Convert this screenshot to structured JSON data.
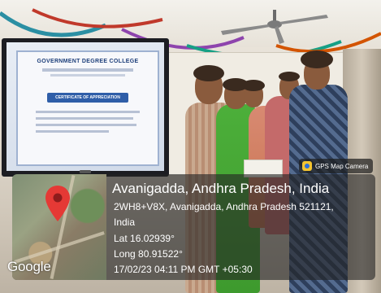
{
  "screen": {
    "college": "GOVERNMENT DEGREE COLLEGE",
    "certificate_title": "CERTIFICATE OF APPRECIATION"
  },
  "badge": {
    "label": "GPS Map Camera",
    "icon": "gps-map-camera-icon"
  },
  "map": {
    "watermark": "Google",
    "pin_color": "#e53935"
  },
  "location": {
    "title": "Avanigadda, Andhra Pradesh, India",
    "address_line1": "2WH8+V8X, Avanigadda, Andhra Pradesh 521121,",
    "address_line2": "India",
    "lat": "Lat 16.02939°",
    "long": "Long 80.91522°",
    "datetime": "17/02/23 04:11 PM GMT +05:30"
  }
}
